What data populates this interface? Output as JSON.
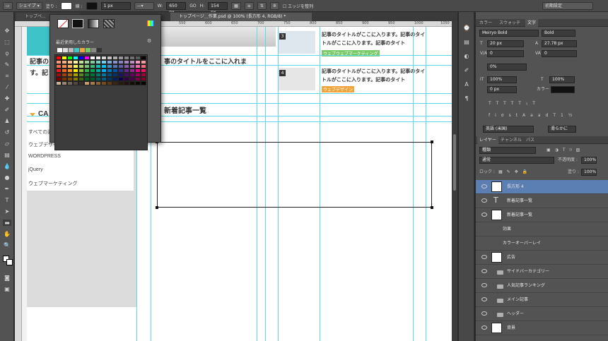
{
  "options_bar": {
    "shape_label": "シェイプ",
    "fill_label": "塗り :",
    "stroke_label": "線 :",
    "stroke_width": "1 px",
    "w_label": "W:",
    "w_value": "650 px",
    "link": "GO",
    "h_label": "H:",
    "h_value": "154 px",
    "align_edges": "エッジを整列",
    "workspace": "初期設定"
  },
  "doc_tabs": [
    {
      "label": "トップペ..."
    },
    {
      "label": "トップページ＿作業.psd @ 100% (長方形 4, RGB/8) *"
    }
  ],
  "ruler_ticks": [
    "500",
    "550",
    "600",
    "650",
    "700",
    "750",
    "800",
    "850",
    "900",
    "950",
    "1000",
    "1050",
    "1100"
  ],
  "document": {
    "heading1": "事のタイトルをここに入れま",
    "heading1_left": "記事の",
    "heading2": "す。記",
    "cat_heading": "CA",
    "section_title": "新着記事一覧",
    "articles": [
      {
        "num": "3",
        "title": "記事のタイトルがここに入ります。記事のタイトルがここに入ります。記事のタイト",
        "tag": "ウェブウェブマーケティング",
        "tag_color": "#7cc96a"
      },
      {
        "num": "4",
        "title": "記事のタイトルがここに入ります。記事のタイトルがここに入ります。記事のタイト",
        "tag": "ウェブデザイン",
        "tag_color": "#f0a43a"
      }
    ],
    "categories": [
      "すべての記事",
      "ウェブデザイン",
      "WORDPRESS",
      "jQuery",
      "ウェブマーケティング"
    ]
  },
  "swatch_popup": {
    "recent_label": "最近使用したカラー",
    "swatch_rows": [
      [
        "#ff0000",
        "#ffff00",
        "#00ff00",
        "#00ffff",
        "#0000ff",
        "#ff00ff",
        "#ffffff",
        "#ebebeb",
        "#d6d6d6",
        "#c2c2c2",
        "#adadad",
        "#999999",
        "#858585",
        "#707070",
        "#5c5c5c",
        "#000000"
      ],
      [
        "#f7977a",
        "#f9ad81",
        "#fdc68a",
        "#fff79a",
        "#c4df9b",
        "#a2d39c",
        "#82ca9d",
        "#7bcdc8",
        "#6ecff6",
        "#7ea7d8",
        "#8493ca",
        "#8882be",
        "#a187be",
        "#bc8dbf",
        "#f49ac2",
        "#f6989d"
      ],
      [
        "#f26c4f",
        "#f68e55",
        "#fbaf5c",
        "#fff467",
        "#acd372",
        "#7cc576",
        "#3bb878",
        "#1abbb4",
        "#00bff3",
        "#438cca",
        "#5574b9",
        "#605ca8",
        "#855fa8",
        "#a763a8",
        "#f06ea9",
        "#f26d7d"
      ],
      [
        "#ed1c24",
        "#f26522",
        "#f7941d",
        "#fff200",
        "#8dc73f",
        "#39b54a",
        "#00a651",
        "#00a99d",
        "#00aeef",
        "#0072bc",
        "#0054a6",
        "#2e3192",
        "#662d91",
        "#92278f",
        "#ec008c",
        "#ed145b"
      ],
      [
        "#9e0b0f",
        "#a0410d",
        "#a3620a",
        "#aba000",
        "#598527",
        "#1a7b30",
        "#007236",
        "#00746b",
        "#0076a3",
        "#004b80",
        "#003471",
        "#1b1464",
        "#440e62",
        "#630460",
        "#9e005d",
        "#9e0039"
      ],
      [
        "#790000",
        "#7b2e00",
        "#7d4900",
        "#827b00",
        "#406618",
        "#005e20",
        "#005826",
        "#005952",
        "#005b7f",
        "#003663",
        "#002157",
        "#0d004c",
        "#32004b",
        "#4b0049",
        "#7b0046",
        "#7a0026"
      ],
      [
        "#c7b299",
        "#998675",
        "#736357",
        "#534741",
        "#37302d",
        "#c69c6d",
        "#a67c52",
        "#8c6239",
        "#754c24",
        "#603913",
        "#3c2415",
        "#2a1a0e",
        "#1e120a",
        "#150c06",
        "#0d0703",
        "#050302"
      ]
    ]
  },
  "right_panel": {
    "tabs": [
      {
        "label": "カラー"
      },
      {
        "label": "スウォッチ"
      },
      {
        "label": "文字"
      }
    ],
    "font_family": "Meiryo Bold",
    "font_style": "Bold",
    "font_size": "20 px",
    "leading": "27.78 px",
    "kerning": "0",
    "tracking": "0",
    "tsume": "0%",
    "v_scale": "100%",
    "h_scale": "100%",
    "baseline": "0 px",
    "color_label": "カラー :",
    "language": "英語 (米国)",
    "aa": "滑らかに",
    "layers_tabs": [
      {
        "label": "レイヤー"
      },
      {
        "label": "チャンネル"
      },
      {
        "label": "パス"
      }
    ],
    "filter_kind": "種類",
    "blend_mode": "通常",
    "opacity_label": "不透明度 :",
    "opacity": "100%",
    "lock_label": "ロック :",
    "fill_label": "塗り :",
    "fill": "100%",
    "layers": [
      {
        "name": "長方形 4",
        "kind": "shape",
        "selected": true
      },
      {
        "name": "新着記事一覧",
        "kind": "text",
        "selected": false
      },
      {
        "name": "新着記事一覧",
        "kind": "shape",
        "selected": false
      },
      {
        "name": "効果",
        "kind": "fx",
        "selected": false
      },
      {
        "name": "カラーオーバーレイ",
        "kind": "fx",
        "selected": false
      },
      {
        "name": "広告",
        "kind": "shape",
        "selected": false
      },
      {
        "name": "サイドバーカテゴリー",
        "kind": "folder",
        "selected": false
      },
      {
        "name": "人気記事ランキング",
        "kind": "folder",
        "selected": false
      },
      {
        "name": "メイン記事",
        "kind": "folder",
        "selected": false
      },
      {
        "name": "ヘッダー",
        "kind": "folder",
        "selected": false
      },
      {
        "name": "背景",
        "kind": "bg",
        "selected": false
      }
    ]
  }
}
